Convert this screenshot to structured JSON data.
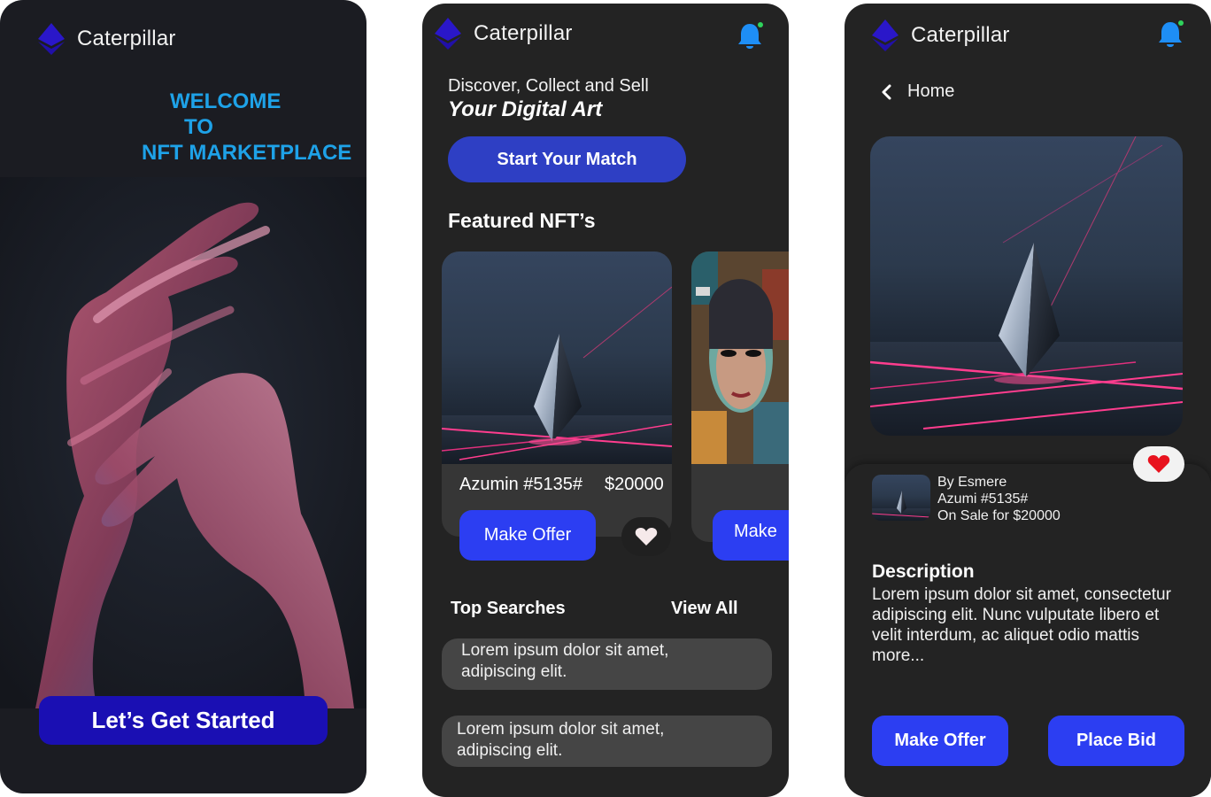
{
  "brand": {
    "name": "Caterpillar",
    "logo_icon": "ethereum-diamond-icon",
    "logo_color": "#2a17c9"
  },
  "colors": {
    "accent": "#2c3ef2",
    "welcome_text": "#1ea2e8",
    "bell": "#1e8ef5",
    "bell_dot": "#2fd35c",
    "heart_red": "#e8121e"
  },
  "welcome_screen": {
    "line1": "WELCOME",
    "line2": "TO",
    "line3": "NFT MARKETPLACE",
    "start_button": "Let’s Get Started"
  },
  "home_screen": {
    "tagline": "Discover, Collect and Sell",
    "tagline_emphasis": "Your Digital Art",
    "match_button": "Start Your Match",
    "featured_title": "Featured NFT’s",
    "featured_card": {
      "name": "Azumin #5135#",
      "price": "$20000",
      "offer_button": "Make Offer"
    },
    "second_card": {
      "offer_button": "Make"
    },
    "top_searches_title": "Top Searches",
    "view_all": "View All",
    "search_items": [
      {
        "line1": "Lorem ipsum dolor sit amet,",
        "line2": "adipiscing elit."
      },
      {
        "line1": "Lorem ipsum dolor sit amet,",
        "line2": "adipiscing elit."
      }
    ]
  },
  "detail_screen": {
    "back_label": "Home",
    "by": "By Esmere",
    "item_name": "Azumi #5135#",
    "sale": "On Sale for $20000",
    "description_title": "Description",
    "description": "Lorem ipsum dolor sit amet, consectetur adipiscing elit. Nunc vulputate libero et velit interdum, ac aliquet odio mattis more...",
    "offer_button": "Make Offer",
    "bid_button": "Place Bid"
  }
}
